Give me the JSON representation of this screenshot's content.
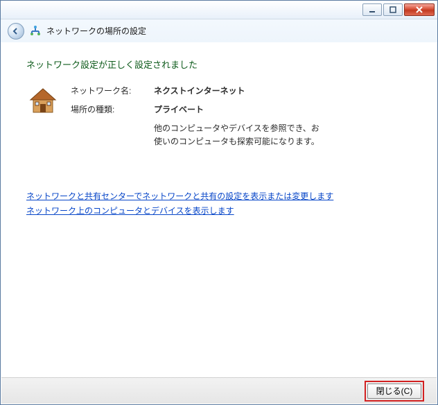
{
  "window": {
    "title": "ネットワークの場所の設定"
  },
  "content": {
    "status": "ネットワーク設定が正しく設定されました",
    "network_name_label": "ネットワーク名:",
    "network_name_value": "ネクストインターネット",
    "location_type_label": "場所の種類:",
    "location_type_value": "プライベート",
    "location_description": "他のコンピュータやデバイスを参照でき、お使いのコンピュータも探索可能になります。"
  },
  "links": {
    "link1": "ネットワークと共有センターでネットワークと共有の設定を表示または変更します",
    "link2": "ネットワーク上のコンピュータとデバイスを表示します"
  },
  "footer": {
    "close_label": "閉じる(C)"
  },
  "icons": {
    "back": "back-arrow",
    "network": "network-icon",
    "home": "home-icon",
    "minimize": "minimize-icon",
    "maximize": "maximize-icon",
    "close_x": "close-icon"
  }
}
